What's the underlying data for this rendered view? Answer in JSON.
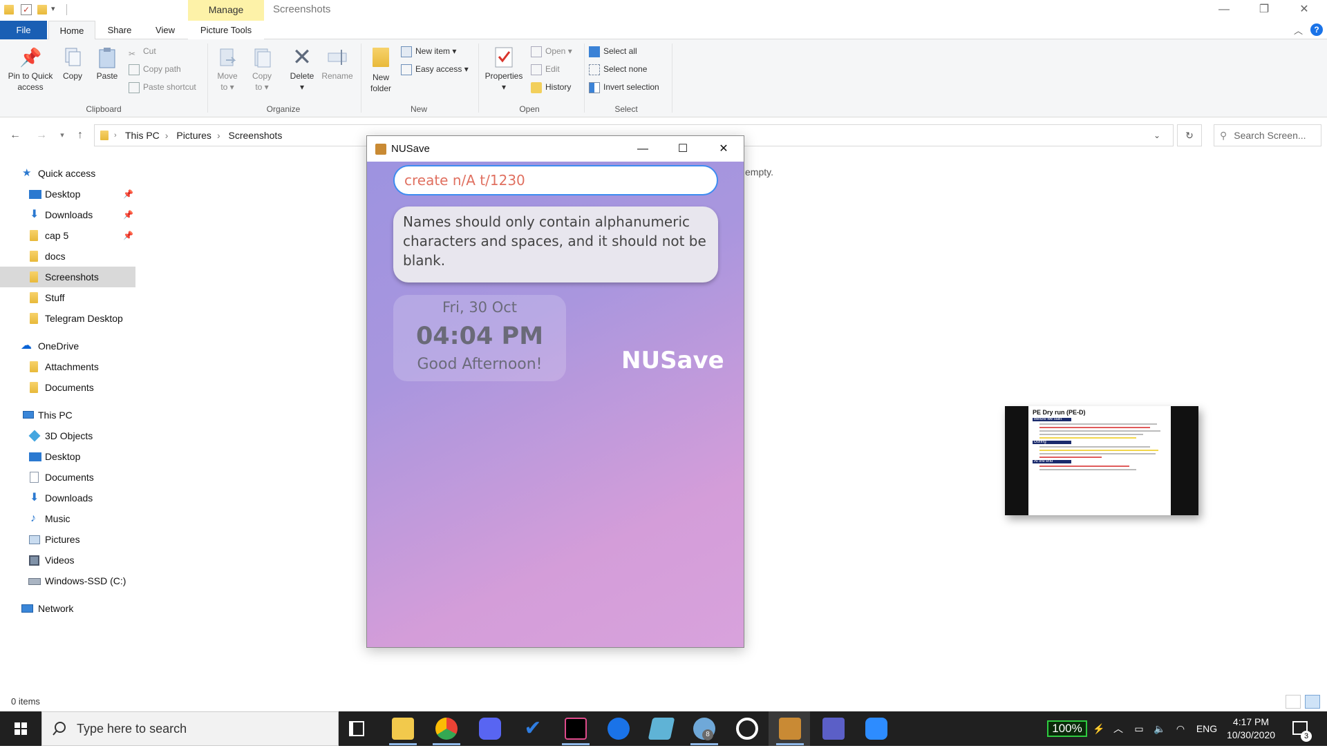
{
  "explorer": {
    "manage_tab": "Manage",
    "window_title": "Screenshots",
    "tabs": {
      "file": "File",
      "home": "Home",
      "share": "Share",
      "view": "View",
      "picture_tools": "Picture Tools"
    },
    "ribbon": {
      "clipboard": {
        "group": "Clipboard",
        "pin_line1": "Pin to Quick",
        "pin_line2": "access",
        "copy": "Copy",
        "paste": "Paste",
        "cut": "Cut",
        "copy_path": "Copy path",
        "paste_shortcut": "Paste shortcut"
      },
      "organize": {
        "group": "Organize",
        "move_line1": "Move",
        "move_line2": "to ▾",
        "copy_line1": "Copy",
        "copy_line2": "to ▾",
        "delete": "Delete",
        "delete_arrow": "▾",
        "rename": "Rename"
      },
      "new": {
        "group": "New",
        "new_folder_line1": "New",
        "new_folder_line2": "folder",
        "new_item": "New item ▾",
        "easy_access": "Easy access ▾"
      },
      "open": {
        "group": "Open",
        "properties": "Properties",
        "properties_arrow": "▾",
        "open": "Open ▾",
        "edit": "Edit",
        "history": "History"
      },
      "select": {
        "group": "Select",
        "select_all": "Select all",
        "select_none": "Select none",
        "invert": "Invert selection"
      }
    },
    "address": {
      "crumbs": [
        "This PC",
        "Pictures",
        "Screenshots"
      ],
      "search_placeholder": "Search Screen..."
    },
    "nav": {
      "quick_access": "Quick access",
      "qa_items": [
        "Desktop",
        "Downloads",
        "cap 5",
        "docs",
        "Screenshots",
        "Stuff",
        "Telegram Desktop"
      ],
      "onedrive": "OneDrive",
      "od_items": [
        "Attachments",
        "Documents"
      ],
      "this_pc": "This PC",
      "pc_items": [
        "3D Objects",
        "Desktop",
        "Documents",
        "Downloads",
        "Music",
        "Pictures",
        "Videos",
        "Windows-SSD (C:)"
      ],
      "network": "Network"
    },
    "content_message": "empty.",
    "status": "0 items",
    "preview": {
      "title": "PE Dry run (PE-D)",
      "headers": [
        "Before we start",
        "During",
        "At the end"
      ]
    }
  },
  "app": {
    "title": "NUSave",
    "command_text": "create n/A t/1230",
    "result_text": "Names should only contain alphanumeric characters and spaces, and it should not be blank.",
    "clock": {
      "date": "Fri, 30 Oct",
      "time": "04:04 PM",
      "greeting": "Good Afternoon!"
    },
    "brand": "NUSave"
  },
  "taskbar": {
    "search_placeholder": "Type here to search",
    "battery": "100%",
    "language": "ENG",
    "time": "4:17 PM",
    "date": "10/30/2020",
    "notification_count": "3",
    "telegram_badge": "8"
  },
  "colors": {
    "file_tab": "#1a5fb4",
    "manage_tab": "#fdf2a8",
    "app_gradient_start": "#9d93e0",
    "app_gradient_end": "#d8a2dc",
    "input_border": "#3d8cf0",
    "command_text": "#e07060",
    "battery_border": "#2ecc40"
  }
}
